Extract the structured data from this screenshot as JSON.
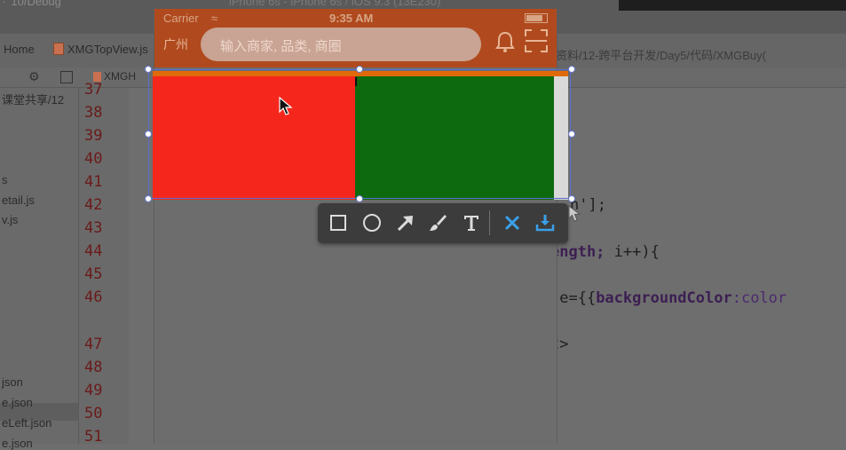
{
  "ide": {
    "title_left": "·' 10/Debug",
    "title_mid": "iPhone 6s - iPhone 6s / iOS 9.3 (13E230)",
    "breadcrumb_home": "Home",
    "breadcrumb_file": "XMGTopView.js",
    "breadcrumb_path": "资料/12-跨平台开发/Day5/代码/XMGBuy(",
    "tab_file": "XMGH",
    "sidebar_items": [
      "课堂共享/12",
      "s",
      "etail.js",
      "v.js",
      "json",
      "e.json",
      "eLeft.json",
      "e.json"
    ],
    "line_numbers": [
      "37",
      "38",
      "39",
      "40",
      "41",
      "42",
      "43",
      "44",
      "45",
      "46",
      "47",
      "48",
      "49",
      "50",
      "51"
    ],
    "code_lines": {
      "l42": "n'];",
      "l44_a": "ength;",
      "l44_b": " i++){",
      "l46_a": ".e={{",
      "l46_b": "backgroundColor",
      "l46_c": ":color",
      "l47": "t>"
    }
  },
  "simulator": {
    "carrier": "Carrier",
    "wifi": "≈",
    "time": "9:35 AM",
    "city": "广州",
    "search_placeholder": "输入商家, 品类, 商圈"
  },
  "capture_regions": {
    "left_color": "#f5271d",
    "right_color": "#0e6a0e",
    "top_bar_color": "#e06a0a"
  },
  "snap_toolbar": {
    "tools": [
      "rectangle-tool",
      "ellipse-tool",
      "arrow-tool",
      "brush-tool",
      "text-tool",
      "cancel",
      "save"
    ]
  },
  "colors": {
    "navbar": "#b04a1e",
    "selection_border": "#5a6ed6",
    "toolbar": "#3c3c3c",
    "cancel": "#3aa0e8",
    "save": "#3aa0e8"
  }
}
